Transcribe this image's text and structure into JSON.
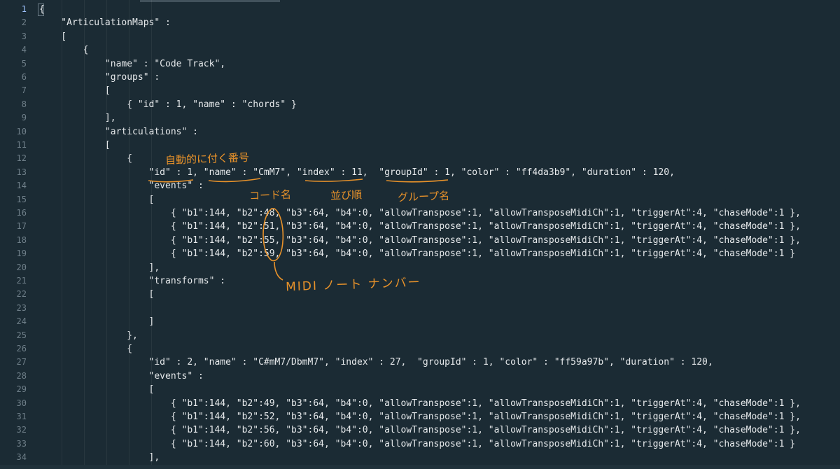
{
  "editor": {
    "accent_color": "#e8922a",
    "background_color": "#1b2b34",
    "line_numbers": [
      "1",
      "2",
      "3",
      "4",
      "5",
      "6",
      "7",
      "8",
      "9",
      "10",
      "11",
      "12",
      "13",
      "14",
      "15",
      "16",
      "17",
      "18",
      "19",
      "20",
      "21",
      "22",
      "23",
      "24",
      "25",
      "26",
      "27",
      "28",
      "29",
      "30",
      "31",
      "32",
      "33",
      "34"
    ],
    "active_line": "1",
    "lines": [
      "{",
      "    \"ArticulationMaps\" :",
      "    [",
      "        {",
      "            \"name\" : \"Code Track\",",
      "            \"groups\" :",
      "            [",
      "                { \"id\" : 1, \"name\" : \"chords\" }",
      "            ],",
      "            \"articulations\" :",
      "            [",
      "                {",
      "                    \"id\" : 1, \"name\" : \"CmM7\", \"index\" : 11,  \"groupId\" : 1, \"color\" : \"ff4da3b9\", \"duration\" : 120,",
      "                    \"events\" :",
      "                    [",
      "                        { \"b1\":144, \"b2\":48, \"b3\":64, \"b4\":0, \"allowTranspose\":1, \"allowTransposeMidiCh\":1, \"triggerAt\":4, \"chaseMode\":1 },",
      "                        { \"b1\":144, \"b2\":51, \"b3\":64, \"b4\":0, \"allowTranspose\":1, \"allowTransposeMidiCh\":1, \"triggerAt\":4, \"chaseMode\":1 },",
      "                        { \"b1\":144, \"b2\":55, \"b3\":64, \"b4\":0, \"allowTranspose\":1, \"allowTransposeMidiCh\":1, \"triggerAt\":4, \"chaseMode\":1 },",
      "                        { \"b1\":144, \"b2\":59, \"b3\":64, \"b4\":0, \"allowTranspose\":1, \"allowTransposeMidiCh\":1, \"triggerAt\":4, \"chaseMode\":1 }",
      "                    ],",
      "                    \"transforms\" :",
      "                    [",
      "",
      "                    ]",
      "                },",
      "                {",
      "                    \"id\" : 2, \"name\" : \"C#mM7/DbmM7\", \"index\" : 27,  \"groupId\" : 1, \"color\" : \"ff59a97b\", \"duration\" : 120,",
      "                    \"events\" :",
      "                    [",
      "                        { \"b1\":144, \"b2\":49, \"b3\":64, \"b4\":0, \"allowTranspose\":1, \"allowTransposeMidiCh\":1, \"triggerAt\":4, \"chaseMode\":1 },",
      "                        { \"b1\":144, \"b2\":52, \"b3\":64, \"b4\":0, \"allowTranspose\":1, \"allowTransposeMidiCh\":1, \"triggerAt\":4, \"chaseMode\":1 },",
      "                        { \"b1\":144, \"b2\":56, \"b3\":64, \"b4\":0, \"allowTranspose\":1, \"allowTransposeMidiCh\":1, \"triggerAt\":4, \"chaseMode\":1 },",
      "                        { \"b1\":144, \"b2\":60, \"b3\":64, \"b4\":0, \"allowTranspose\":1, \"allowTransposeMidiCh\":1, \"triggerAt\":4, \"chaseMode\":1 }",
      "                    ],"
    ]
  },
  "annotations": {
    "auto_number": "自動的に付く番号",
    "chord_name": "コード名",
    "order": "並び順",
    "group_name": "グループ名",
    "midi_note_number": "MIDI ノート ナンバー"
  }
}
